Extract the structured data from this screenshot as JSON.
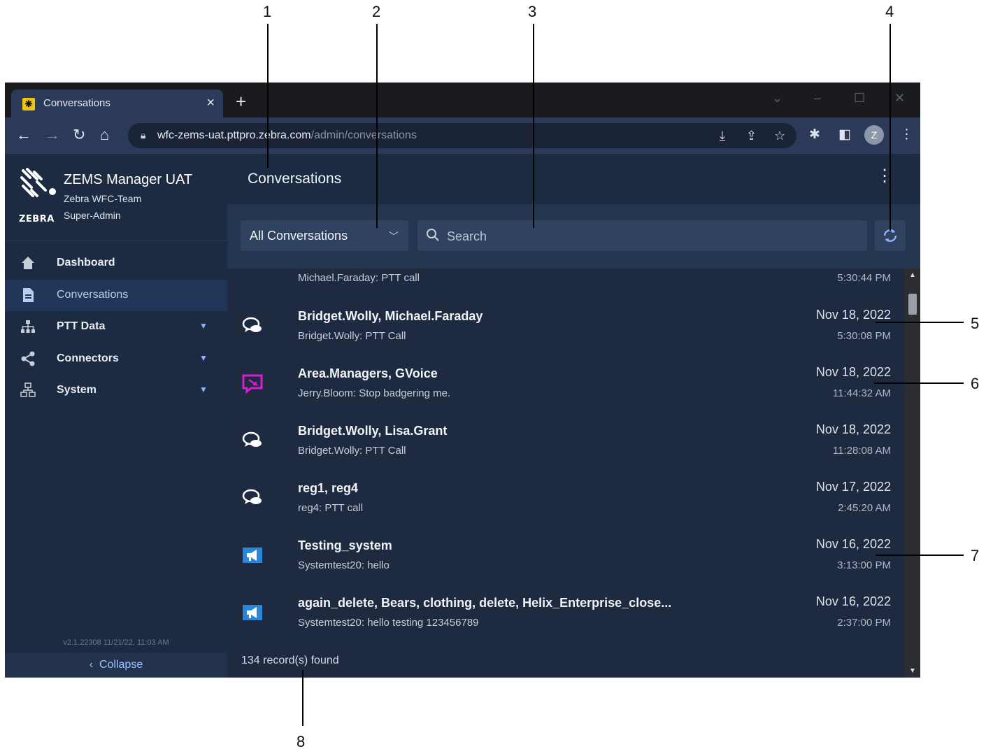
{
  "callouts": [
    "1",
    "2",
    "3",
    "4",
    "5",
    "6",
    "7",
    "8"
  ],
  "browser": {
    "tab_title": "Conversations",
    "tab_close": "×",
    "new_tab": "+",
    "url_host": "wfc-zems-uat.pttpro.zebra.com",
    "url_path": "/admin/conversations",
    "profile_initial": "Z"
  },
  "sidebar": {
    "app_title": "ZEMS Manager UAT",
    "team": "Zebra WFC-Team",
    "role": "Super-Admin",
    "logo_word": "ZEBRA",
    "items": [
      {
        "label": "Dashboard",
        "icon": "home-icon",
        "active": false,
        "expandable": false
      },
      {
        "label": "Conversations",
        "icon": "document-icon",
        "active": true,
        "expandable": false
      },
      {
        "label": "PTT Data",
        "icon": "hierarchy-icon",
        "active": false,
        "expandable": true
      },
      {
        "label": "Connectors",
        "icon": "share-icon",
        "active": false,
        "expandable": true
      },
      {
        "label": "System",
        "icon": "network-icon",
        "active": false,
        "expandable": true
      }
    ],
    "version": "v2.1.22308 11/21/22, 11:03 AM",
    "collapse_label": "Collapse"
  },
  "main": {
    "title": "Conversations",
    "filter": {
      "selected": "All Conversations"
    },
    "search": {
      "placeholder": "Search",
      "value": ""
    },
    "partial_row": {
      "subtitle": "Michael.Faraday: PTT call",
      "time": "5:30:44 PM"
    },
    "rows": [
      {
        "title": "Bridget.Wolly, Michael.Faraday",
        "subtitle": "Bridget.Wolly: PTT Call",
        "date": "Nov 18, 2022",
        "time": "5:30:08 PM",
        "icon": "chat-bubbles-icon"
      },
      {
        "title": "Area.Managers, GVoice",
        "subtitle": "Jerry.Bloom: Stop badgering me.",
        "date": "Nov 18, 2022",
        "time": "11:44:32 AM",
        "icon": "gvoice-icon"
      },
      {
        "title": "Bridget.Wolly, Lisa.Grant",
        "subtitle": "Bridget.Wolly: PTT Call",
        "date": "Nov 18, 2022",
        "time": "11:28:08 AM",
        "icon": "chat-bubbles-icon"
      },
      {
        "title": "reg1, reg4",
        "subtitle": "reg4: PTT call",
        "date": "Nov 17, 2022",
        "time": "2:45:20 AM",
        "icon": "chat-bubbles-icon"
      },
      {
        "title": "Testing_system",
        "subtitle": "Systemtest20: hello",
        "date": "Nov 16, 2022",
        "time": "3:13:00 PM",
        "icon": "megaphone-icon"
      },
      {
        "title": "again_delete, Bears, clothing, delete, Helix_Enterprise_close...",
        "subtitle": "Systemtest20: hello testing 123456789",
        "date": "Nov 16, 2022",
        "time": "2:37:00 PM",
        "icon": "megaphone-icon"
      }
    ],
    "records_found": "134 record(s) found"
  },
  "colors": {
    "sidebar_bg": "#1c2a42",
    "toolbar_bg": "#24364f",
    "list_bg": "#1d2a40",
    "accent": "#9ec0ff",
    "gvoice": "#d21fd2",
    "broadcast": "#2a86d8"
  }
}
